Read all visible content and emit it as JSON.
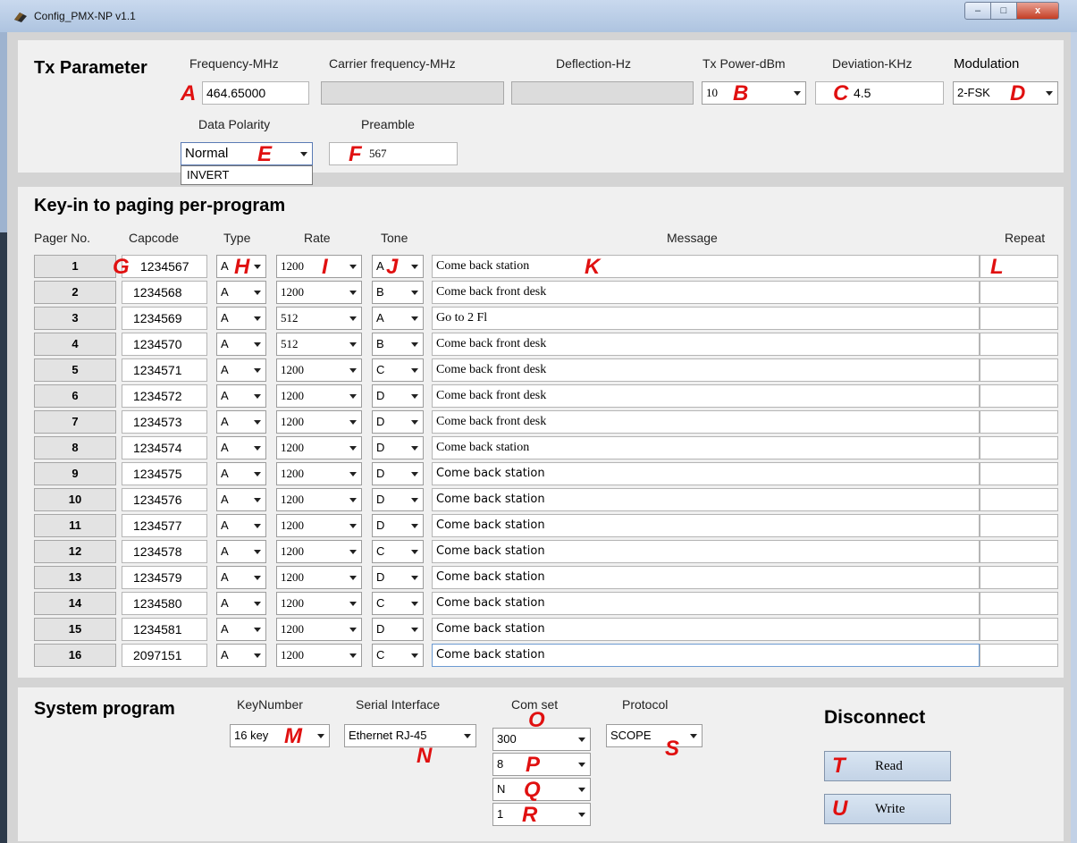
{
  "window": {
    "title": "Config_PMX-NP v1.1",
    "min_glyph": "–",
    "max_glyph": "□",
    "close_glyph": "x"
  },
  "tx": {
    "section_title": "Tx Parameter",
    "frequency_label": "Frequency-MHz",
    "frequency_value": "464.65000",
    "carrier_label": "Carrier frequency-MHz",
    "deflection_label": "Deflection-Hz",
    "power_label": "Tx Power-dBm",
    "power_value": "10",
    "deviation_label": "Deviation-KHz",
    "deviation_value": "4.5",
    "modulation_label": "Modulation",
    "modulation_value": "2-FSK",
    "polarity_label": "Data Polarity",
    "polarity_value": "Normal",
    "polarity_option_invert": "INVERT",
    "preamble_label": "Preamble",
    "preamble_value": "567"
  },
  "keyin": {
    "section_title": "Key-in to paging per-program",
    "headers": {
      "pager": "Pager No.",
      "capcode": "Capcode",
      "type": "Type",
      "rate": "Rate",
      "tone": "Tone",
      "message": "Message",
      "repeat": "Repeat"
    },
    "rows": [
      {
        "no": "1",
        "capcode": "1234567",
        "type": "A",
        "rate": "1200",
        "tone": "A",
        "message": "Come back station",
        "repeat": ""
      },
      {
        "no": "2",
        "capcode": "1234568",
        "type": "A",
        "rate": "1200",
        "tone": "B",
        "message": "Come back front desk",
        "repeat": ""
      },
      {
        "no": "3",
        "capcode": "1234569",
        "type": "A",
        "rate": "512",
        "tone": "A",
        "message": "Go to 2 Fl",
        "repeat": ""
      },
      {
        "no": "4",
        "capcode": "1234570",
        "type": "A",
        "rate": "512",
        "tone": "B",
        "message": "Come back front desk",
        "repeat": ""
      },
      {
        "no": "5",
        "capcode": "1234571",
        "type": "A",
        "rate": "1200",
        "tone": "C",
        "message": "Come back front desk",
        "repeat": ""
      },
      {
        "no": "6",
        "capcode": "1234572",
        "type": "A",
        "rate": "1200",
        "tone": "D",
        "message": "Come back front desk",
        "repeat": ""
      },
      {
        "no": "7",
        "capcode": "1234573",
        "type": "A",
        "rate": "1200",
        "tone": "D",
        "message": "Come back front desk",
        "repeat": ""
      },
      {
        "no": "8",
        "capcode": "1234574",
        "type": "A",
        "rate": "1200",
        "tone": "D",
        "message": "Come back station",
        "repeat": ""
      },
      {
        "no": "9",
        "capcode": "1234575",
        "type": "A",
        "rate": "1200",
        "tone": "D",
        "message": "Come back station",
        "repeat": ""
      },
      {
        "no": "10",
        "capcode": "1234576",
        "type": "A",
        "rate": "1200",
        "tone": "D",
        "message": "Come back station",
        "repeat": ""
      },
      {
        "no": "11",
        "capcode": "1234577",
        "type": "A",
        "rate": "1200",
        "tone": "D",
        "message": "Come back station",
        "repeat": ""
      },
      {
        "no": "12",
        "capcode": "1234578",
        "type": "A",
        "rate": "1200",
        "tone": "C",
        "message": "Come back station",
        "repeat": ""
      },
      {
        "no": "13",
        "capcode": "1234579",
        "type": "A",
        "rate": "1200",
        "tone": "D",
        "message": "Come back station",
        "repeat": ""
      },
      {
        "no": "14",
        "capcode": "1234580",
        "type": "A",
        "rate": "1200",
        "tone": "C",
        "message": "Come back station",
        "repeat": ""
      },
      {
        "no": "15",
        "capcode": "1234581",
        "type": "A",
        "rate": "1200",
        "tone": "D",
        "message": "Come back station",
        "repeat": ""
      },
      {
        "no": "16",
        "capcode": "2097151",
        "type": "A",
        "rate": "1200",
        "tone": "C",
        "message": "Come back station",
        "repeat": ""
      }
    ]
  },
  "system": {
    "section_title": "System program",
    "keynumber_label": "KeyNumber",
    "keynumber_value": "16 key",
    "serial_label": "Serial Interface",
    "serial_value": "Ethernet RJ-45",
    "comset_label": "Com set",
    "comset_baud": "300",
    "comset_databits": "8",
    "comset_parity": "N",
    "comset_stopbits": "1",
    "protocol_label": "Protocol",
    "protocol_value": "SCOPE",
    "status_text": "Disconnect",
    "read_label": "Read",
    "write_label": "Write"
  },
  "annotations": {
    "A": "A",
    "B": "B",
    "C": "C",
    "D": "D",
    "E": "E",
    "F": "F",
    "G": "G",
    "H": "H",
    "I": "I",
    "J": "J",
    "K": "K",
    "L": "L",
    "M": "M",
    "N": "N",
    "O": "O",
    "P": "P",
    "Q": "Q",
    "R": "R",
    "S": "S",
    "T": "T",
    "U": "U"
  },
  "colors": {
    "annotation_red": "#e01010",
    "panel_bg": "#f0f0f0",
    "window_frame": "#b8c6d8"
  }
}
